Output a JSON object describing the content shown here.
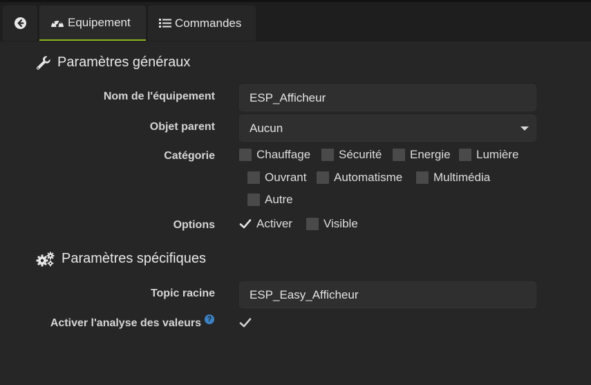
{
  "tabs": {
    "back_icon": "arrow-circle-left-icon",
    "equipement": "Equipement",
    "commandes": "Commandes",
    "accent_color": "#8bb91f"
  },
  "general": {
    "title": "Paramètres généraux",
    "name_label": "Nom de l'équipement",
    "name_value": "ESP_Afficheur",
    "parent_label": "Objet parent",
    "parent_value": "Aucun",
    "category_label": "Catégorie",
    "categories": [
      {
        "label": "Chauffage",
        "checked": false
      },
      {
        "label": "Sécurité",
        "checked": false
      },
      {
        "label": "Energie",
        "checked": false
      },
      {
        "label": "Lumière",
        "checked": false
      },
      {
        "label": "Ouvrant",
        "checked": false
      },
      {
        "label": "Automatisme",
        "checked": false
      },
      {
        "label": "Multimédia",
        "checked": false
      },
      {
        "label": "Autre",
        "checked": false
      }
    ],
    "options_label": "Options",
    "options": [
      {
        "label": "Activer",
        "checked": true
      },
      {
        "label": "Visible",
        "checked": false
      }
    ]
  },
  "specific": {
    "title": "Paramètres spécifiques",
    "topic_label": "Topic racine",
    "topic_value": "ESP_Easy_Afficheur",
    "analyse_label": "Activer l'analyse des valeurs",
    "analyse_help": "?",
    "analyse_checked": true
  }
}
